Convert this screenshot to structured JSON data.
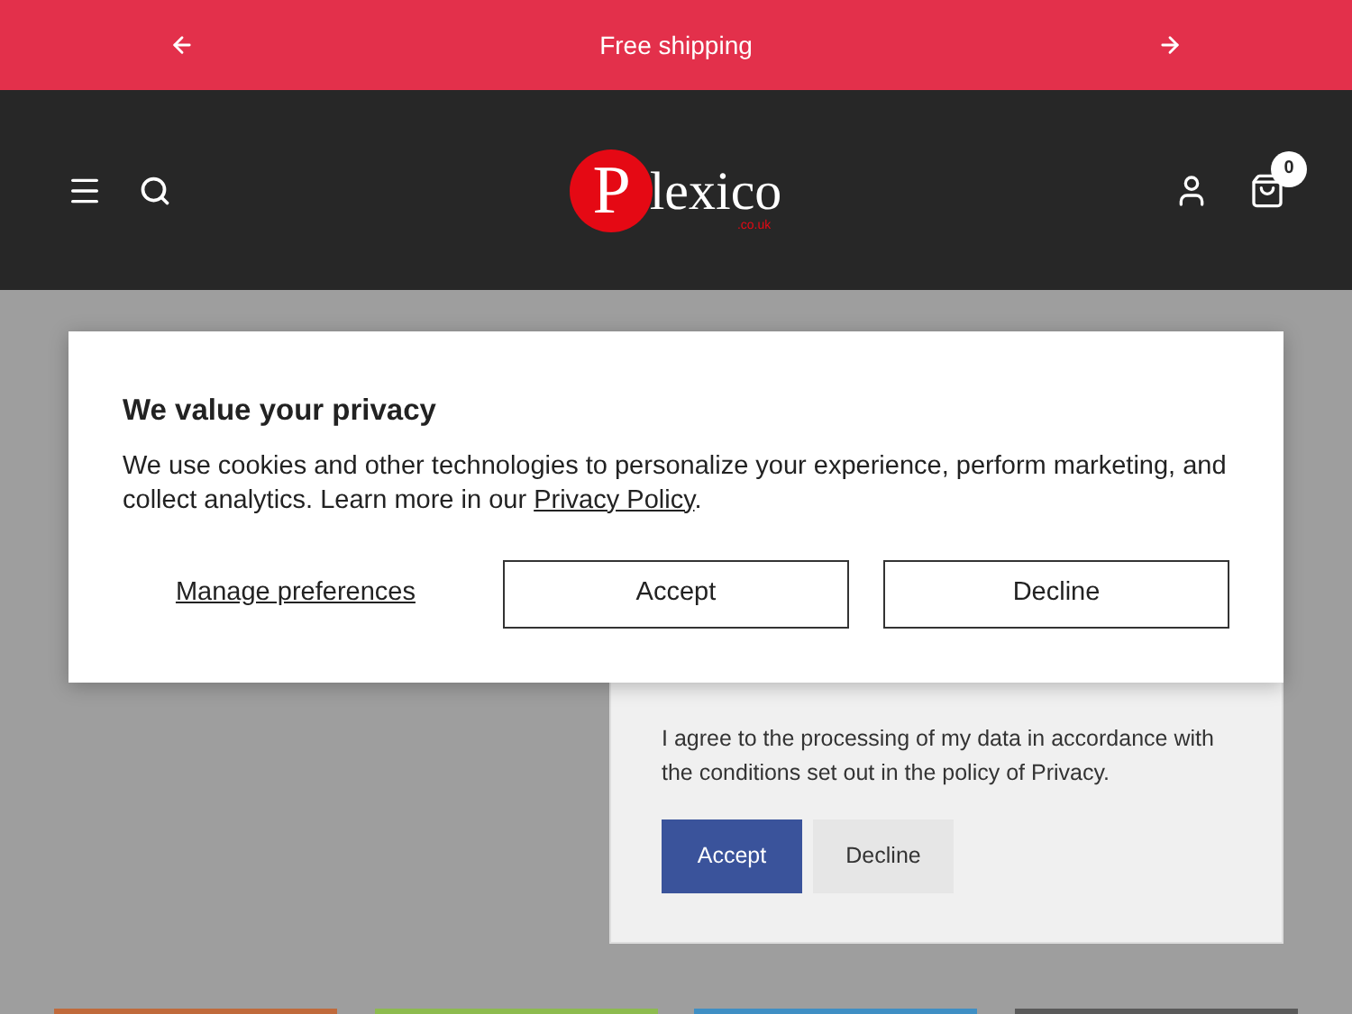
{
  "announcement": {
    "text": "Free shipping"
  },
  "header": {
    "logo": {
      "letter": "P",
      "word": "lexico",
      "domain": ".co.uk"
    },
    "cart_count": "0"
  },
  "privacy_dialog": {
    "title": "We value your privacy",
    "body": "We use cookies and other technologies to personalize your experience, perform marketing, and collect analytics. Learn more in our ",
    "link": "Privacy Policy",
    "end": ".",
    "manage": "Manage preferences",
    "buttons": [
      "Accept",
      "Decline"
    ]
  },
  "cookie_panel": {
    "text": "I agree to the processing of my data in accordance with the conditions set out in the policy of Privacy.",
    "buttons": [
      {
        "label": "Accept",
        "kind": "primary"
      },
      {
        "label": "Decline",
        "kind": "secondary"
      }
    ]
  },
  "strips": [
    {
      "color": "#c06a3c"
    },
    {
      "color": "#8dbb4f"
    },
    {
      "color": "#3f8fc4"
    },
    {
      "color": "#5a5a5a"
    }
  ]
}
